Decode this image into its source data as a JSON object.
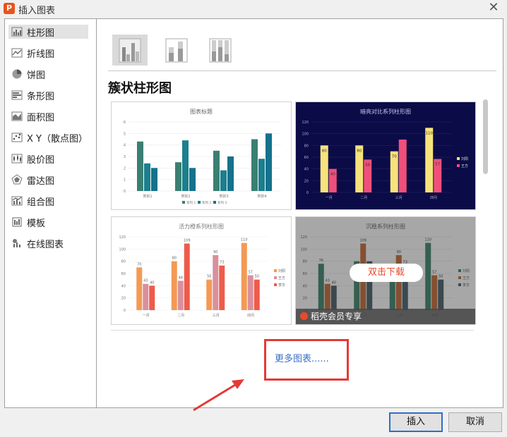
{
  "window": {
    "title": "插入图表",
    "app_icon_letter": "P",
    "close_glyph": "✕"
  },
  "sidebar": {
    "items": [
      {
        "label": "柱形图",
        "icon": "column-chart-icon",
        "selected": true
      },
      {
        "label": "折线图",
        "icon": "line-chart-icon"
      },
      {
        "label": "饼图",
        "icon": "pie-chart-icon"
      },
      {
        "label": "条形图",
        "icon": "bar-chart-icon"
      },
      {
        "label": "面积图",
        "icon": "area-chart-icon"
      },
      {
        "label": "X Y（散点图）",
        "icon": "scatter-chart-icon"
      },
      {
        "label": "股价图",
        "icon": "stock-chart-icon"
      },
      {
        "label": "雷达图",
        "icon": "radar-chart-icon"
      },
      {
        "label": "组合图",
        "icon": "combo-chart-icon"
      },
      {
        "label": "模板",
        "icon": "template-icon"
      },
      {
        "label": "在线图表",
        "icon": "online-chart-icon"
      }
    ]
  },
  "section_title": "簇状柱形图",
  "subtypes": [
    "clustered-column",
    "stacked-column",
    "percent-stacked-column"
  ],
  "templates": [
    {
      "name": "default",
      "chart_data": {
        "type": "bar",
        "title": "图表标题",
        "categories": [
          "类别1",
          "类别2",
          "类别3",
          "类别4"
        ],
        "y_ticks": [
          "0",
          "1",
          "2",
          "3",
          "4",
          "5",
          "6"
        ],
        "ylim": [
          0,
          6
        ],
        "series": [
          {
            "name": "系列 1",
            "values": [
              4.3,
              2.5,
              3.5,
              4.5
            ],
            "color": "#3a7f72"
          },
          {
            "name": "系列 2",
            "values": [
              2.4,
              4.4,
              1.8,
              2.8
            ],
            "color": "#1a7f8f"
          },
          {
            "name": "系列 3",
            "values": [
              2.0,
              2.0,
              3.0,
              5.0
            ],
            "color": "#15718c"
          }
        ],
        "legend": "bottom"
      }
    },
    {
      "name": "dark",
      "chart_data": {
        "type": "bar",
        "title": "暗亮对比系列柱形图",
        "categories": [
          "一月",
          "二月",
          "三月",
          "四月"
        ],
        "y_ticks": [
          "0",
          "20",
          "40",
          "60",
          "80",
          "100",
          "120"
        ],
        "ylim": [
          0,
          120
        ],
        "series": [
          {
            "name": "刘阳",
            "values": [
              80,
              80,
              70,
              110
            ],
            "labels": [
              "80",
              "80",
              "70",
              "110"
            ],
            "color": "#f7e37a"
          },
          {
            "name": "王方",
            "values": [
              40,
              56,
              90,
              57
            ],
            "labels": [
              "40",
              "56",
              "",
              "57"
            ],
            "color": "#ef4f7b"
          }
        ],
        "legend": "right"
      }
    },
    {
      "name": "vivid",
      "chart_data": {
        "type": "bar",
        "title": "活力橙系列柱形图",
        "categories": [
          "一月",
          "二月",
          "三月",
          "四月"
        ],
        "y_ticks": [
          "0",
          "20",
          "40",
          "60",
          "80",
          "100",
          "120"
        ],
        "ylim": [
          0,
          120
        ],
        "series": [
          {
            "name": "刘阳",
            "values": [
              70,
              80,
              50,
              110
            ],
            "labels": [
              "70",
              "80",
              "50",
              "110"
            ],
            "color": "#f39a55"
          },
          {
            "name": "王方",
            "values": [
              43,
              48,
              90,
              57
            ],
            "labels": [
              "43",
              "48",
              "90",
              "57"
            ],
            "color": "#d9909c"
          },
          {
            "name": "李华",
            "values": [
              40,
              109,
              73,
              50
            ],
            "labels": [
              "40",
              "109",
              "73",
              "50"
            ],
            "color": "#ee5b4a"
          }
        ],
        "legend": "right"
      }
    },
    {
      "name": "calm",
      "download_label": "双击下载",
      "member_label": "稻壳会员专享",
      "chart_data": {
        "type": "bar",
        "title": "沉稳系列柱形图",
        "categories": [
          "一月",
          "二月",
          "三月",
          "四月"
        ],
        "y_ticks": [
          "0",
          "20",
          "40",
          "60",
          "80",
          "100",
          "120"
        ],
        "ylim": [
          0,
          120
        ],
        "series": [
          {
            "name": "刘阳",
            "values": [
              76,
              80,
              60,
              110
            ],
            "labels": [
              "76",
              "",
              "",
              "110"
            ],
            "color": "#2f7d63"
          },
          {
            "name": "王方",
            "values": [
              43,
              109,
              90,
              57
            ],
            "labels": [
              "43",
              "109",
              "90",
              "57"
            ],
            "color": "#c0622a"
          },
          {
            "name": "李华",
            "values": [
              40,
              80,
              73,
              50
            ],
            "labels": [
              "40",
              "",
              "73",
              "50"
            ],
            "color": "#3a5560"
          }
        ],
        "legend": "right"
      }
    }
  ],
  "more_charts_label": "更多图表......",
  "buttons": {
    "insert": "插入",
    "cancel": "取消"
  },
  "colors": {
    "highlight": "#e53935",
    "link": "#3a6fc4",
    "dark_bg": "#0b0b48"
  }
}
